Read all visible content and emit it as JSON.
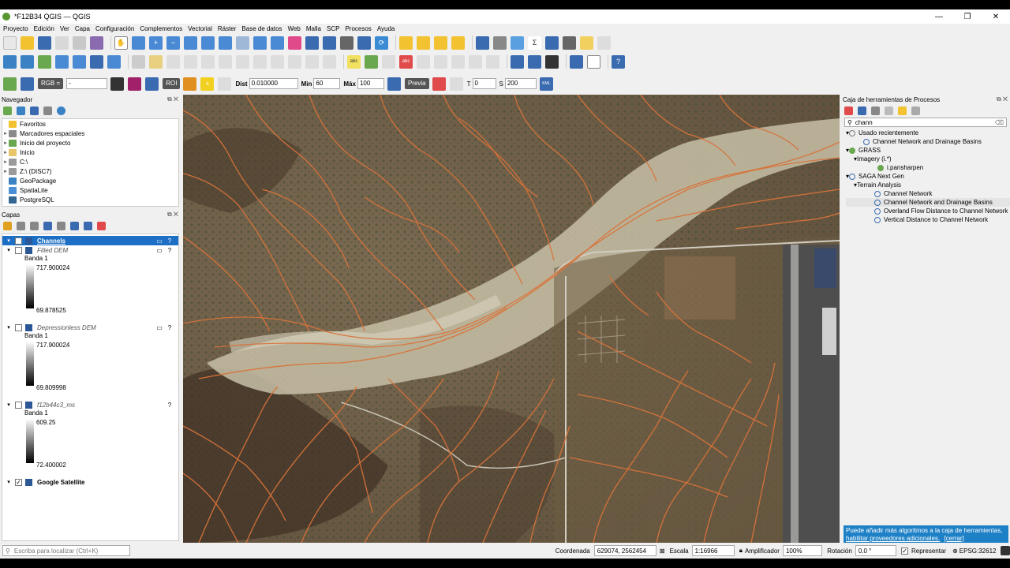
{
  "window": {
    "title": "*F12B34 QGIS — QGIS"
  },
  "menu": [
    "Proyecto",
    "Edición",
    "Ver",
    "Capa",
    "Configuración",
    "Complementos",
    "Vectorial",
    "Ráster",
    "Base de datos",
    "Web",
    "Malla",
    "SCP",
    "Procesos",
    "Ayuda"
  ],
  "scp": {
    "rgb_label": "RGB =",
    "roi_label": "ROI",
    "dist_label": "Dist",
    "dist_value": "0.010000",
    "min_label": "Min",
    "min_value": "60",
    "max_label": "Máx",
    "max_value": "100",
    "preview_label": "Previa",
    "t_label": "T",
    "t_value": "0",
    "s_label": "S",
    "s_value": "200",
    "kml_label": "KML"
  },
  "navigator": {
    "title": "Navegador",
    "items": [
      {
        "label": "Favoritos",
        "color": "#f2c230"
      },
      {
        "label": "Marcadores espaciales",
        "color": "#8a8a8a"
      },
      {
        "label": "Inicio del proyecto",
        "color": "#6aa84f"
      },
      {
        "label": "Inicio",
        "color": "#e8c66a"
      },
      {
        "label": "C:\\",
        "color": "#9a9a9a"
      },
      {
        "label": "Z:\\ (DISC7)",
        "color": "#9a9a9a"
      },
      {
        "label": "GeoPackage",
        "color": "#3a82c4"
      },
      {
        "label": "SpatiaLite",
        "color": "#4a90d9"
      },
      {
        "label": "PostgreSQL",
        "color": "#336791"
      }
    ]
  },
  "layers": {
    "title": "Capas",
    "items": [
      {
        "name": "Channels",
        "checked": true,
        "selected": true,
        "italic": false
      },
      {
        "name": "Filled DEM",
        "checked": false,
        "italic": true,
        "band": "Banda 1",
        "max": "717.900024",
        "min": "69.878525"
      },
      {
        "name": "Depressionless DEM",
        "checked": false,
        "italic": true,
        "band": "Banda 1",
        "max": "717.900024",
        "min": "69.809998"
      },
      {
        "name": "f12b44c3_ms",
        "checked": false,
        "italic": true,
        "band": "Banda 1",
        "max": "609.25",
        "min": "72.400002"
      },
      {
        "name": "Google Satellite",
        "checked": true,
        "italic": false
      }
    ]
  },
  "toolbox": {
    "title": "Caja de herramientas de Procesos",
    "search": "chann",
    "recent_label": "Usado recientemente",
    "recent_item": "Channel Network and Drainage Basins",
    "grass_label": "GRASS",
    "imagery_label": "Imagery (i.*)",
    "pansharpen": "i.pansharpen",
    "saga_label": "SAGA Next Gen",
    "terrain_label": "Terrain Analysis",
    "terrain_items": [
      "Channel Network",
      "Channel Network and Drainage Basins",
      "Overland Flow Distance to Channel Network",
      "Vertical Distance to Channel Network"
    ],
    "info_text": "Puede añadir más algoritmos a la caja de herramientas,",
    "info_link": "habilitar proveedores adicionales.",
    "info_close": "[cerrar]"
  },
  "status": {
    "locator_placeholder": "Escriba para localizar (Ctrl+K)",
    "coord_label": "Coordenada",
    "coord_value": "629074, 2562454",
    "scale_label": "Escala",
    "scale_value": "1:16966",
    "mag_label": "Amplificador",
    "mag_value": "100%",
    "rot_label": "Rotación",
    "rot_value": "0.0 °",
    "render_label": "Representar",
    "crs": "EPSG:32612"
  },
  "colors": {
    "channel": "#d9733a",
    "accent": "#0078d7",
    "selected": "#1c6fc4"
  }
}
